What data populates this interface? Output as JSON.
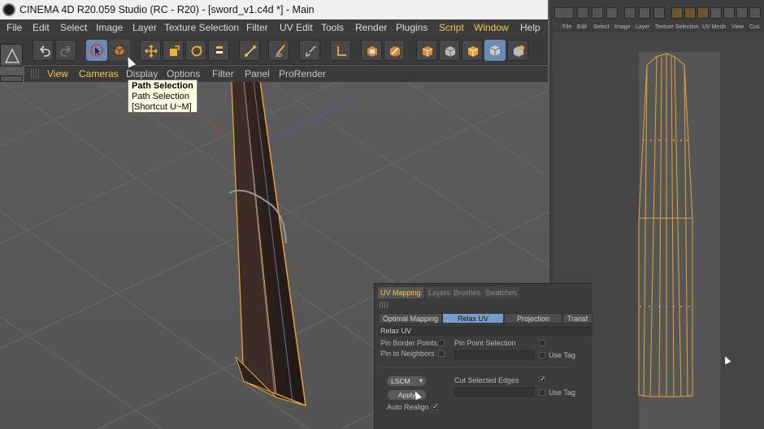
{
  "window": {
    "title": "CINEMA 4D R20.059 Studio (RC - R20) - [sword_v1.c4d *] - Main"
  },
  "menu": [
    {
      "label": "File",
      "highlight": false
    },
    {
      "label": "Edit",
      "highlight": false
    },
    {
      "label": "Select",
      "highlight": false
    },
    {
      "label": "Image",
      "highlight": false
    },
    {
      "label": "Layer",
      "highlight": false
    },
    {
      "label": "Texture Selection",
      "highlight": false
    },
    {
      "label": "Filter",
      "highlight": false
    },
    {
      "label": "UV Edit",
      "highlight": false
    },
    {
      "label": "Tools",
      "highlight": false
    },
    {
      "label": "Render",
      "highlight": false
    },
    {
      "label": "Plugins",
      "highlight": false
    },
    {
      "label": "Script",
      "highlight": true
    },
    {
      "label": "Window",
      "highlight": true
    },
    {
      "label": "Help",
      "highlight": false
    }
  ],
  "toolbar": {
    "icons": [
      "undo-icon",
      "redo-icon",
      "live-selection-icon",
      "texture-mode-icon",
      "move-icon",
      "scale-icon",
      "rotate-icon",
      "magnet-icon",
      "uv-points-icon",
      "brush-3d-icon",
      "paint-icon",
      "uv-angle-icon",
      "render-view-icon",
      "render-queue-icon",
      "view-cube-1-icon",
      "view-cube-2-icon",
      "view-cube-3-icon",
      "view-cube-4-icon",
      "view-cube-5-icon"
    ]
  },
  "viewport_menu": [
    {
      "label": "View",
      "highlight": true
    },
    {
      "label": "Cameras",
      "highlight": true
    },
    {
      "label": "Display",
      "highlight": false
    },
    {
      "label": "Options",
      "highlight": false
    },
    {
      "label": "Filter",
      "highlight": false
    },
    {
      "label": "Panel",
      "highlight": false
    },
    {
      "label": "ProRender",
      "highlight": false
    }
  ],
  "tooltip": {
    "title": "Path Selection",
    "subtitle": "Path Selection",
    "shortcut": "[Shortcut U~M]"
  },
  "uv_window": {
    "menu": [
      "File",
      "Edit",
      "Select",
      "Image",
      "Layer",
      "Texture Selection",
      "UV Mesh",
      "View",
      "Cus"
    ]
  },
  "attributes": {
    "tabs": [
      {
        "label": "UV Mapping",
        "active": true
      },
      {
        "label": "Layers",
        "active": false
      },
      {
        "label": "Brushes",
        "active": false
      },
      {
        "label": "Swatches",
        "active": false
      }
    ],
    "modes": [
      {
        "label": "Optimal Mapping",
        "active": false
      },
      {
        "label": "Relax UV",
        "active": true
      },
      {
        "label": "Projection",
        "active": false
      },
      {
        "label": "Transf",
        "active": false
      }
    ],
    "section": "Relax UV",
    "pin_border_points": "Pin Border Points",
    "pin_to_neighbors": "Pin to Neighbors",
    "pin_point_selection": "Pin Point Selection",
    "use_tag_1": "Use Tag",
    "method": "LSCM",
    "apply": "Apply",
    "auto_realign": "Auto Realign",
    "cut_selected_edges": "Cut Selected Edges",
    "use_tag_2": "Use Tag"
  },
  "colors": {
    "accent": "#f2c94c",
    "selection": "#6a8cb8",
    "mesh_wire": "#e8a23a",
    "viewport_bg": "#5a5a5a"
  }
}
